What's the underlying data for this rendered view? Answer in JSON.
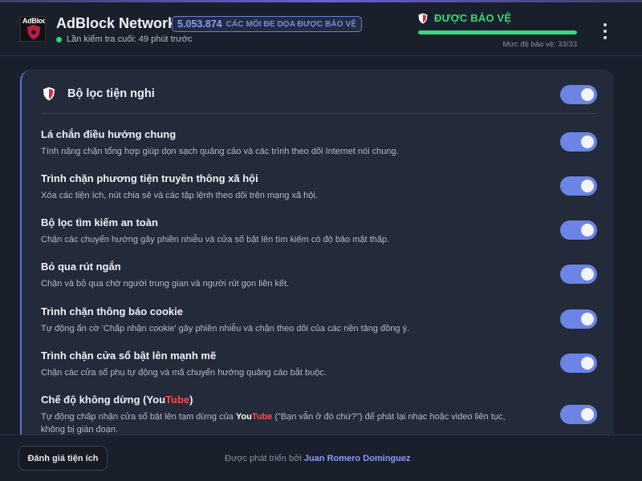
{
  "header": {
    "logo_text": "AdBlock",
    "app_title": "AdBlock Network",
    "threat_count": "5.053.874",
    "threat_label": "CÁC MỐI ĐE DỌA ĐƯỢC BẢO VỆ",
    "last_check": "Lần kiểm tra cuối: 49 phút trước",
    "status_text": "ĐƯỢC BẢO VỆ",
    "protection_level_text": "Mức độ bảo vệ: 33/33",
    "protection_fraction": 1.0,
    "status_color": "#3bd977",
    "accent_color": "#6b84e6"
  },
  "card": {
    "title": "Bộ lọc tiện nghi",
    "master_enabled": true,
    "rows": [
      {
        "title": "Lá chắn điều hướng chung",
        "desc": "Tính năng chặn tổng hợp giúp dọn sạch quảng cáo và các trình theo dõi Internet nói chung.",
        "enabled": true
      },
      {
        "title": "Trình chặn phương tiện truyền thông xã hội",
        "desc": "Xóa các tiện ích, nút chia sẻ và các tập lệnh theo dõi trên mạng xã hội.",
        "enabled": true
      },
      {
        "title": "Bộ lọc tìm kiếm an toàn",
        "desc": "Chặn các chuyển hướng gây phiền nhiễu và cửa sổ bật lên tìm kiếm có độ bảo mật thấp.",
        "enabled": true
      },
      {
        "title": "Bỏ qua rút ngắn",
        "desc": "Chặn và bỏ qua chờ người trung gian và người rút gọn liên kết.",
        "enabled": true
      },
      {
        "title": "Trình chặn thông báo cookie",
        "desc": "Tự động ẩn cờ 'Chấp nhận cookie' gây phiền nhiễu và chặn theo dõi của các nền tảng đồng ý.",
        "enabled": true
      },
      {
        "title": "Trình chặn cửa sổ bật lên mạnh mẽ",
        "desc": "Chặn các cửa sổ phụ tự động và mã chuyển hướng quảng cáo bắt buộc.",
        "enabled": true
      }
    ],
    "nonstop": {
      "title_prefix": "Chế độ không dừng (",
      "title_you": "You",
      "title_tube": "Tube",
      "title_suffix": ")",
      "desc_prefix": "Tự động chấp nhận cửa sổ bật lên tạm dừng của ",
      "desc_you": "You",
      "desc_tube": "Tube",
      "desc_suffix": " (\"Bạn vẫn ở đó chứ?\") để phát lại nhạc hoặc video liên tục, không bị gián đoạn.",
      "enabled": true
    }
  },
  "footer": {
    "rate_button": "Đánh giá tiện ích",
    "credit_prefix": "Được phát triển bởi",
    "credit_author": "Juan Romero Dominguez"
  }
}
